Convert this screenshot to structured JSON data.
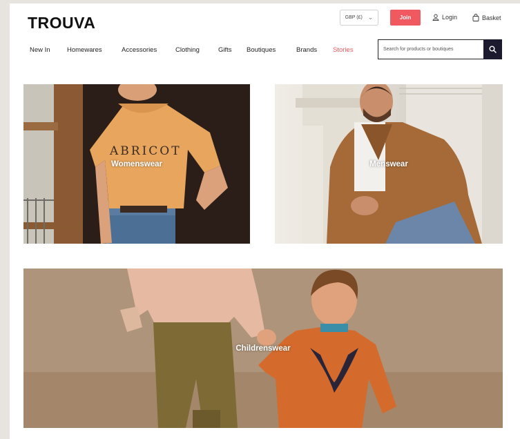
{
  "header": {
    "logo": "TROUVA",
    "currency": "GBP (£)",
    "join_label": "Join",
    "login_label": "Login",
    "basket_label": "Basket"
  },
  "nav": {
    "items": [
      "New In",
      "Homewares",
      "Accessories",
      "Clothing",
      "Gifts",
      "Boutiques",
      "Brands",
      "Stories"
    ]
  },
  "search": {
    "placeholder": "Search for products or boutiques"
  },
  "tiles": {
    "womenswear": "Womenswear",
    "menswear": "Menswear",
    "childrenswear": "Childrenswear",
    "shirt_print": "ABRICOT"
  },
  "colors": {
    "accent": "#f0595f",
    "search_button": "#1b1a2f"
  }
}
